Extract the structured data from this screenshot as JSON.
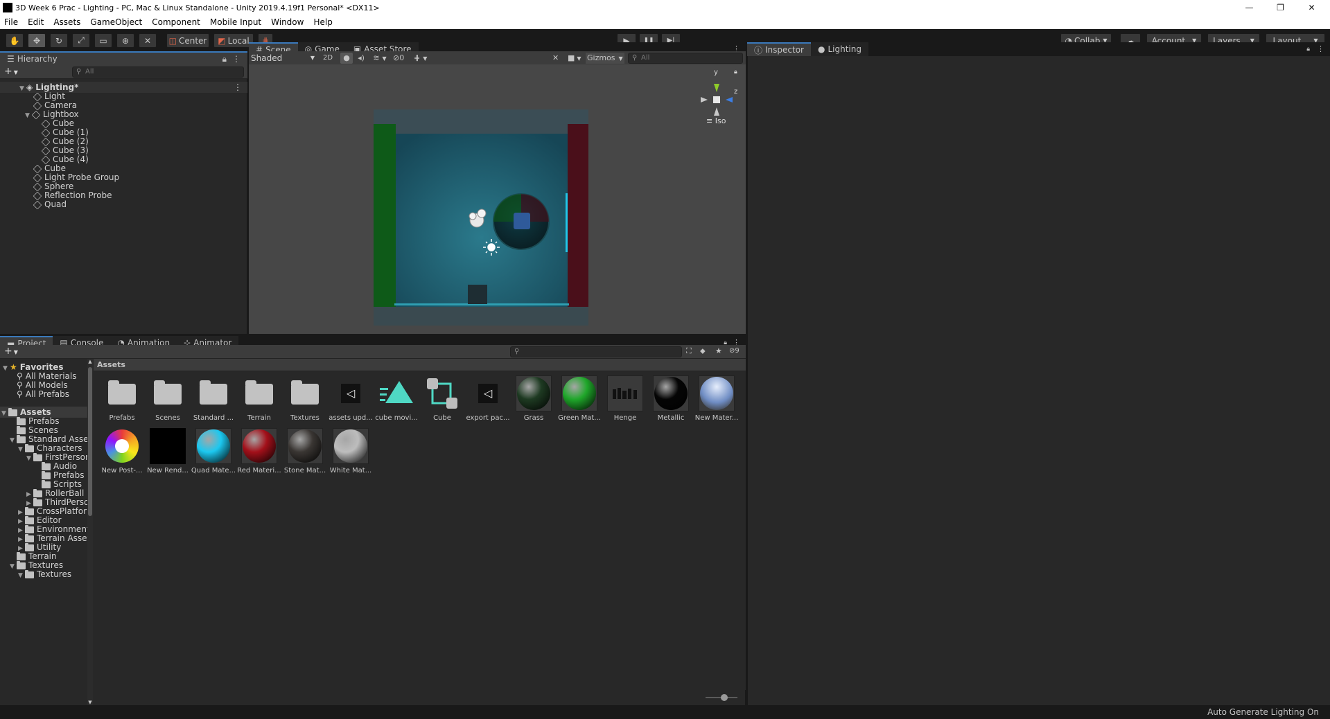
{
  "window": {
    "title": "3D Week 6 Prac - Lighting - PC, Mac & Linux Standalone - Unity 2019.4.19f1 Personal* <DX11>",
    "controls": {
      "minimize": "—",
      "restore": "❐",
      "close": "✕"
    }
  },
  "menu": [
    "File",
    "Edit",
    "Assets",
    "GameObject",
    "Component",
    "Mobile Input",
    "Window",
    "Help"
  ],
  "toolbar": {
    "tools": [
      "hand-icon",
      "move-icon",
      "rotate-icon",
      "scale-icon",
      "rect-icon",
      "transform-icon",
      "custom-tool-icon"
    ],
    "pivot_label": "Center",
    "space_label": "Local",
    "grid_icon": "grid-snap-icon",
    "play": "▶",
    "pause": "❚❚",
    "step": "▶|",
    "collab_label": "Collab",
    "cloud_icon": "cloud-icon",
    "account_label": "Account",
    "layers_label": "Layers",
    "layout_label": "Layout"
  },
  "hierarchy": {
    "tab_label": "Hierarchy",
    "search_placeholder": "All",
    "scene_name": "Lighting*",
    "items": [
      {
        "label": "Light",
        "depth": 1,
        "expanded": null
      },
      {
        "label": "Camera",
        "depth": 1,
        "expanded": null
      },
      {
        "label": "Lightbox",
        "depth": 1,
        "expanded": true
      },
      {
        "label": "Cube",
        "depth": 2,
        "expanded": null
      },
      {
        "label": "Cube (1)",
        "depth": 2,
        "expanded": null
      },
      {
        "label": "Cube (2)",
        "depth": 2,
        "expanded": null
      },
      {
        "label": "Cube (3)",
        "depth": 2,
        "expanded": null
      },
      {
        "label": "Cube (4)",
        "depth": 2,
        "expanded": null
      },
      {
        "label": "Cube",
        "depth": 1,
        "expanded": null
      },
      {
        "label": "Light Probe Group",
        "depth": 1,
        "expanded": null
      },
      {
        "label": "Sphere",
        "depth": 1,
        "expanded": null
      },
      {
        "label": "Reflection Probe",
        "depth": 1,
        "expanded": null
      },
      {
        "label": "Quad",
        "depth": 1,
        "expanded": null
      }
    ]
  },
  "scene_view": {
    "tabs": [
      "Scene",
      "Game",
      "Asset Store"
    ],
    "shading_mode": "Shaded",
    "mode_2d": "2D",
    "hidden_count": "0",
    "gizmos_label": "Gizmos",
    "search_placeholder": "All",
    "gizmo_axes": {
      "y": "y",
      "z": "z"
    },
    "projection_label": "Iso"
  },
  "inspector": {
    "tabs": [
      "Inspector",
      "Lighting"
    ]
  },
  "project": {
    "tabs": [
      "Project",
      "Console",
      "Animation",
      "Animator"
    ],
    "breadcrumb": "Assets",
    "hidden_packages_count": "9",
    "favorites": {
      "label": "Favorites",
      "items": [
        "All Materials",
        "All Models",
        "All Prefabs"
      ]
    },
    "tree": [
      {
        "label": "Assets",
        "depth": 0,
        "arrow": "▼",
        "bold": true
      },
      {
        "label": "Prefabs",
        "depth": 1,
        "arrow": ""
      },
      {
        "label": "Scenes",
        "depth": 1,
        "arrow": ""
      },
      {
        "label": "Standard Assets",
        "depth": 1,
        "arrow": "▼"
      },
      {
        "label": "Characters",
        "depth": 2,
        "arrow": "▼"
      },
      {
        "label": "FirstPersonCh",
        "depth": 3,
        "arrow": "▼"
      },
      {
        "label": "Audio",
        "depth": 4,
        "arrow": ""
      },
      {
        "label": "Prefabs",
        "depth": 4,
        "arrow": ""
      },
      {
        "label": "Scripts",
        "depth": 4,
        "arrow": ""
      },
      {
        "label": "RollerBall",
        "depth": 3,
        "arrow": "▶"
      },
      {
        "label": "ThirdPersonC",
        "depth": 3,
        "arrow": "▶"
      },
      {
        "label": "CrossPlatformIn",
        "depth": 2,
        "arrow": "▶"
      },
      {
        "label": "Editor",
        "depth": 2,
        "arrow": "▶"
      },
      {
        "label": "Environment",
        "depth": 2,
        "arrow": "▶"
      },
      {
        "label": "Terrain Assets",
        "depth": 2,
        "arrow": "▶"
      },
      {
        "label": "Utility",
        "depth": 2,
        "arrow": "▶"
      },
      {
        "label": "Terrain",
        "depth": 1,
        "arrow": ""
      },
      {
        "label": "Textures",
        "depth": 1,
        "arrow": "▼"
      },
      {
        "label": "Textures",
        "depth": 2,
        "arrow": "▼"
      }
    ],
    "assets": [
      {
        "label": "Prefabs",
        "kind": "folder"
      },
      {
        "label": "Scenes",
        "kind": "folder"
      },
      {
        "label": "Standard ...",
        "kind": "folder"
      },
      {
        "label": "Terrain",
        "kind": "folder"
      },
      {
        "label": "Textures",
        "kind": "folder"
      },
      {
        "label": "assets upd...",
        "kind": "unity"
      },
      {
        "label": "cube movi...",
        "kind": "anim"
      },
      {
        "label": "Cube",
        "kind": "controller"
      },
      {
        "label": "export pac...",
        "kind": "unity"
      },
      {
        "label": "Grass",
        "kind": "sphere",
        "color": "#1e3a22"
      },
      {
        "label": "Green Mat...",
        "kind": "sphere",
        "color": "#1fa72a"
      },
      {
        "label": "Henge",
        "kind": "model"
      },
      {
        "label": "Metallic",
        "kind": "sphere",
        "color": "#050505"
      },
      {
        "label": "New Mater...",
        "kind": "sky"
      },
      {
        "label": "New Post-...",
        "kind": "post"
      },
      {
        "label": "New Rend...",
        "kind": "black"
      },
      {
        "label": "Quad Mate...",
        "kind": "sphere",
        "color": "#1cc8f0"
      },
      {
        "label": "Red Materi...",
        "kind": "sphere",
        "color": "#a3101a"
      },
      {
        "label": "Stone Mat...",
        "kind": "sphere",
        "color": "#3a3633"
      },
      {
        "label": "White Mat...",
        "kind": "sphere",
        "color": "#bdbdbd"
      }
    ]
  },
  "status": {
    "right_text": "Auto Generate Lighting On"
  },
  "colors": {
    "accent": "#3a79bb",
    "scene_background": "#474747",
    "lightbox_floor": "#1f5a6a",
    "left_wall": "#0e5a18",
    "right_wall": "#4a0f1a"
  }
}
